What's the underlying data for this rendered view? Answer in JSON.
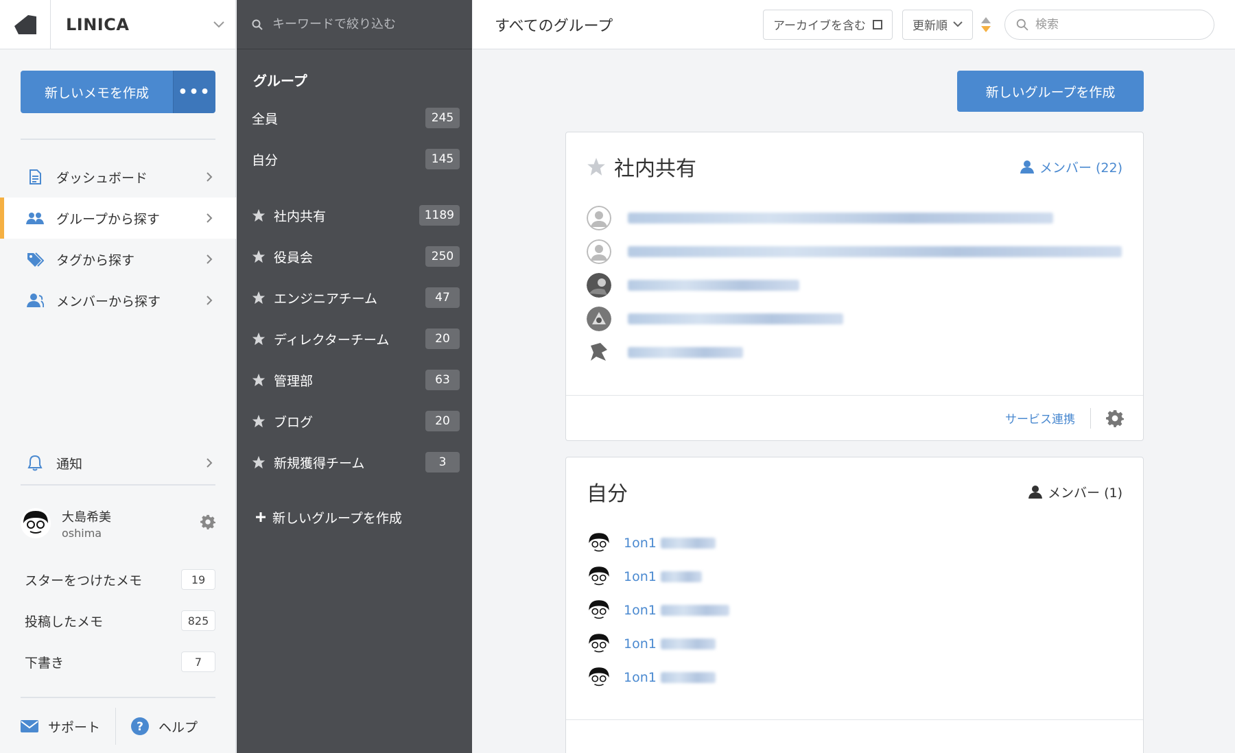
{
  "brand": {
    "name": "LINICA"
  },
  "left": {
    "new_memo": "新しいメモを作成",
    "more": "•••",
    "nav": [
      {
        "label": "ダッシュボード",
        "icon": "document-icon"
      },
      {
        "label": "グループから探す",
        "icon": "group-icon",
        "active": true
      },
      {
        "label": "タグから探す",
        "icon": "tag-icon"
      },
      {
        "label": "メンバーから探す",
        "icon": "member-icon"
      }
    ],
    "notify": "通知",
    "user": {
      "name": "大島希美",
      "id": "oshima"
    },
    "stats": [
      {
        "label": "スターをつけたメモ",
        "count": "19"
      },
      {
        "label": "投稿したメモ",
        "count": "825"
      },
      {
        "label": "下書き",
        "count": "7"
      }
    ],
    "support": "サポート",
    "help": "ヘルプ"
  },
  "groups": {
    "search_placeholder": "キーワードで絞り込む",
    "heading": "グループ",
    "items": [
      {
        "label": "全員",
        "count": "245",
        "star": false
      },
      {
        "label": "自分",
        "count": "145",
        "star": false
      },
      {
        "label": "社内共有",
        "count": "1189",
        "star": true
      },
      {
        "label": "役員会",
        "count": "250",
        "star": true
      },
      {
        "label": "エンジニアチーム",
        "count": "47",
        "star": true
      },
      {
        "label": "ディレクターチーム",
        "count": "20",
        "star": true
      },
      {
        "label": "管理部",
        "count": "63",
        "star": true
      },
      {
        "label": "ブログ",
        "count": "20",
        "star": true
      },
      {
        "label": "新規獲得チーム",
        "count": "3",
        "star": true
      }
    ],
    "new_group": "新しいグループを作成"
  },
  "main": {
    "title": "すべてのグループ",
    "archive": "アーカイブを含む",
    "sort": "更新順",
    "search_placeholder": "検索",
    "new_group_button": "新しいグループを作成",
    "cards": [
      {
        "title": "社内共有",
        "members": "メンバー (22)",
        "service": "サービス連携"
      },
      {
        "title": "自分",
        "members": "メンバー (1)"
      }
    ],
    "self_memos": [
      "1on1",
      "1on1",
      "1on1",
      "1on1",
      "1on1"
    ]
  },
  "colors": {
    "accent": "#4a89d0",
    "active_marker": "#f5b042",
    "group_panel": "#4b4d51"
  }
}
